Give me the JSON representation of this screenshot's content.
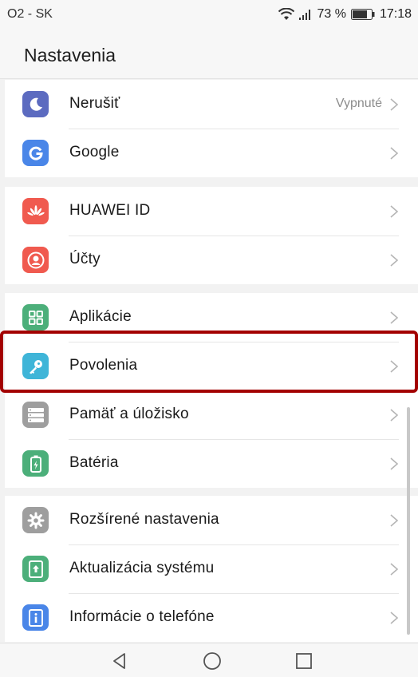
{
  "status_bar": {
    "carrier": "O2 - SK",
    "battery": "73 %",
    "time": "17:18"
  },
  "header": {
    "title": "Nastavenia"
  },
  "groups": [
    {
      "items": [
        {
          "label": "Nerušiť",
          "value": "Vypnuté",
          "icon": "moon-icon",
          "color": "#5c6bc0"
        },
        {
          "label": "Google",
          "icon": "google-icon",
          "color": "#4a86e8"
        }
      ]
    },
    {
      "items": [
        {
          "label": "HUAWEI ID",
          "icon": "huawei-icon",
          "color": "#f05a4f"
        },
        {
          "label": "Účty",
          "icon": "account-icon",
          "color": "#f05a4f"
        }
      ]
    },
    {
      "items": [
        {
          "label": "Aplikácie",
          "icon": "apps-icon",
          "color": "#4caf7a"
        },
        {
          "label": "Povolenia",
          "icon": "key-icon",
          "color": "#3fb5d8"
        },
        {
          "label": "Pamäť a úložisko",
          "icon": "storage-icon",
          "color": "#9e9e9e"
        },
        {
          "label": "Batéria",
          "icon": "battery-icon",
          "color": "#4caf7a"
        }
      ]
    },
    {
      "items": [
        {
          "label": "Rozšírené nastavenia",
          "icon": "gear-icon",
          "color": "#9e9e9e"
        },
        {
          "label": "Aktualizácia systému",
          "icon": "update-icon",
          "color": "#4caf7a"
        },
        {
          "label": "Informácie o telefóne",
          "icon": "info-icon",
          "color": "#4a86e8"
        }
      ]
    }
  ],
  "highlight_color": "#a30000",
  "nav": {
    "back": "back-icon",
    "home": "home-icon",
    "recents": "recents-icon"
  }
}
